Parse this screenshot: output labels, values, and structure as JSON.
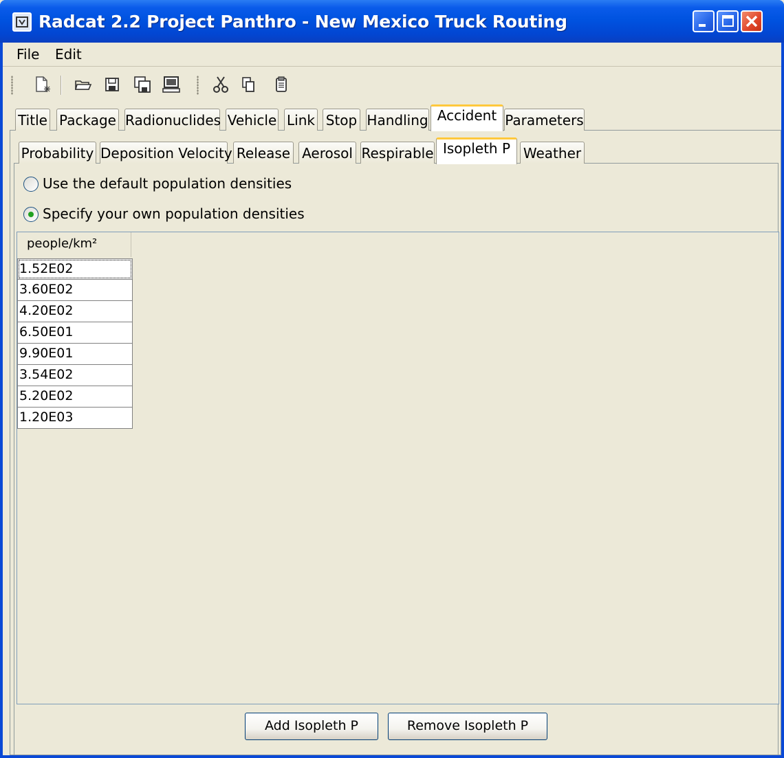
{
  "window": {
    "title": "Radcat 2.2 Project Panthro - New Mexico Truck Routing",
    "icons": [
      "minimize-icon",
      "maximize-icon",
      "close-icon"
    ]
  },
  "menu": [
    "File",
    "Edit"
  ],
  "toolbar": {
    "icons": [
      "new-file-icon",
      "open-folder-icon",
      "save-icon",
      "save-all-icon",
      "computer-icon",
      "cut-icon",
      "copy-icon",
      "paste-icon"
    ]
  },
  "main_tabs": [
    "Title",
    "Package",
    "Radionuclides",
    "Vehicle",
    "Link",
    "Stop",
    "Handling",
    "Accident",
    "Parameters"
  ],
  "main_tab_selected": "Accident",
  "sub_tabs": [
    "Probability",
    "Deposition Velocity",
    "Release",
    "Aerosol",
    "Respirable",
    "Isopleth P",
    "Weather"
  ],
  "sub_tab_selected": "Isopleth P",
  "options": {
    "default": "Use the default population densities",
    "custom": "Specify your own population densities",
    "selected": "custom"
  },
  "table": {
    "header": "people/km²",
    "rows": [
      "1.52E02",
      "3.60E02",
      "4.20E02",
      "6.50E01",
      "9.90E01",
      "3.54E02",
      "5.20E02",
      "1.20E03"
    ]
  },
  "buttons": {
    "add": "Add Isopleth P",
    "remove": "Remove Isopleth P"
  }
}
